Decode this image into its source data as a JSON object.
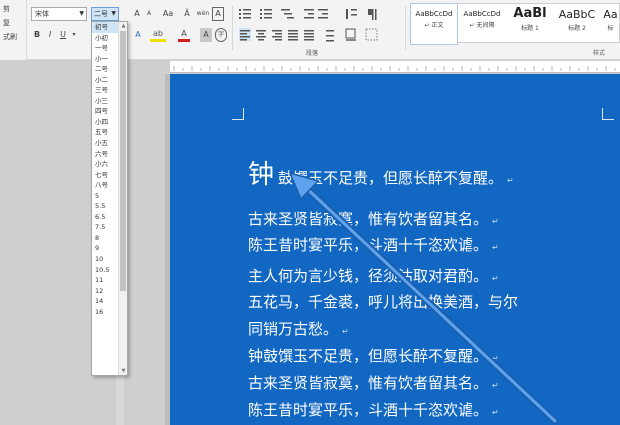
{
  "ribbon": {
    "clipboard_labels": [
      "剪",
      "复",
      "式刷"
    ],
    "font_name": "宋体",
    "font_size": "二号",
    "grow_font": "A",
    "shrink_font": "A",
    "change_case": "Aa",
    "clear_format": "Ȁ",
    "phonetic": "wén",
    "border_char": "A",
    "bold": "B",
    "italic": "I",
    "underline": "U",
    "text_effect": "A",
    "highlight": "ab",
    "font_color": "A",
    "char_shading": "A",
    "enclose": "字",
    "paragraph_label": "段落",
    "styles_label": "样式",
    "styles": [
      {
        "sample": "AaBbCcDd",
        "label": "↵ 正文"
      },
      {
        "sample": "AaBbCcDd",
        "label": "↵ 无间隔"
      },
      {
        "sample": "AaBl",
        "label": "标题 1"
      },
      {
        "sample": "AaBbC",
        "label": "标题 2"
      },
      {
        "sample": "Aa",
        "label": "标"
      }
    ]
  },
  "font_size_dropdown": {
    "selected": "初号",
    "options": [
      "初号",
      "小初",
      "一号",
      "小一",
      "二号",
      "小二",
      "三号",
      "小三",
      "四号",
      "小四",
      "五号",
      "小五",
      "六号",
      "小六",
      "七号",
      "八号",
      "5",
      "5.5",
      "6.5",
      "7.5",
      "8",
      "9",
      "10",
      "10.5",
      "11",
      "12",
      "14",
      "16"
    ]
  },
  "document": {
    "first_char": "钟",
    "lines": [
      "鼓馔玉不足贵，但愿长醉不复醒。",
      "古来圣贤皆寂寞，惟有饮者留其名。",
      "陈王昔时宴平乐，斗酒十千恣欢谑。",
      "主人何为言少钱，径须沽取对君酌。",
      "五花马，千金裘，呼儿将出换美酒，与尔",
      "同销万古愁。",
      "钟鼓馔玉不足贵，但愿长醉不复醒。",
      "古来圣贤皆寂寞，惟有饮者留其名。",
      "陈王昔时宴平乐，斗酒十千恣欢谑。"
    ],
    "page_color": "#1167c1"
  }
}
